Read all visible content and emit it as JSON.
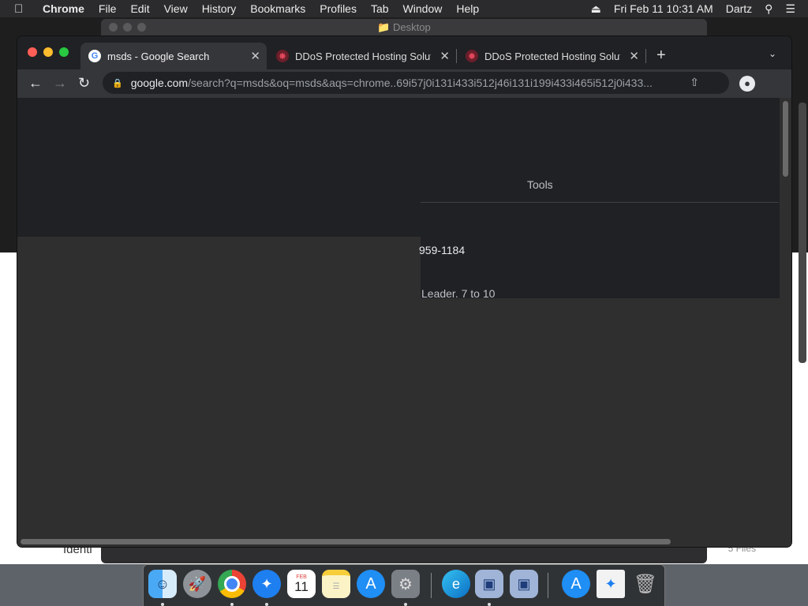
{
  "menubar": {
    "app": "Chrome",
    "items": [
      "File",
      "Edit",
      "View",
      "History",
      "Bookmarks",
      "Profiles",
      "Tab",
      "Window",
      "Help"
    ],
    "datetime": "Fri Feb 11  10:31 AM",
    "user": "Dartz"
  },
  "finder": {
    "title": "Desktop",
    "file_count": "5 Files",
    "partial_label": "Identi"
  },
  "tabs": [
    {
      "title": "msds - Google Search",
      "favicon": "google-icon"
    },
    {
      "title": "DDoS Protected Hosting Soluti",
      "favicon": "ddos-site-icon"
    },
    {
      "title": "DDoS Protected Hosting Soluti",
      "favicon": "ddos-site-icon"
    }
  ],
  "omnibox": {
    "host": "google.com",
    "path": "/search?q=msds&oq=msds&aqs=chrome..69i57j0i131i433i512j46i131i199i433i465i512j0i433..."
  },
  "page": {
    "tools_label": "Tools",
    "snippet_1": "959-1184",
    "snippet_2": "Leader. 7 to 10"
  },
  "dock": {
    "apps": [
      "finder-icon",
      "launchpad-icon",
      "chrome-icon",
      "safari-icon",
      "calendar-icon",
      "notes-icon",
      "app-store-icon",
      "system-preferences-icon",
      "edge-icon",
      "virtualbox-icon",
      "virtualbox-icon-2",
      "app-store-downloads-icon",
      "download-file-icon",
      "trash-icon"
    ],
    "calendar_month": "FEB",
    "calendar_day": "11"
  },
  "colors": {
    "close": "#ff5f57",
    "minimize": "#febc2e",
    "zoom": "#28c840",
    "chrome_dark": "#202124",
    "content_gray": "#2f2f2f"
  }
}
